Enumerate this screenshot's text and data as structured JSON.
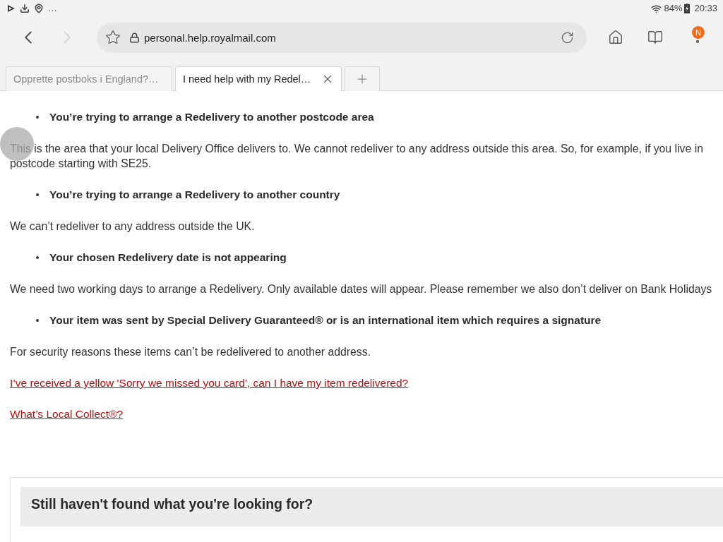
{
  "status_bar": {
    "more_notifications": "…",
    "battery": "84%",
    "time": "20:33"
  },
  "toolbar": {
    "nav": [
      {
        "kind": "back",
        "disabled": false
      },
      {
        "kind": "forward",
        "disabled": true
      }
    ],
    "url": "personal.help.royalmail.com",
    "menu_badge": "N"
  },
  "tabs": [
    {
      "title": "Opprette postboks i England?…",
      "selected": false
    },
    {
      "title": "I need help with my Redel…",
      "selected": true
    }
  ],
  "article": {
    "blocks": [
      {
        "kind": "bullet",
        "text": "You’re trying to arrange a Redelivery to another postcode area"
      },
      {
        "kind": "paragraph",
        "lines": [
          "This is the area that your local Delivery Office delivers to. We cannot redeliver to any address outside this area. So, for example, if you live in",
          "postcode starting with SE25."
        ]
      },
      {
        "kind": "bullet",
        "text": "You’re trying to arrange a Redelivery to another country"
      },
      {
        "kind": "paragraph",
        "lines": [
          "We can’t redeliver to any address outside the UK."
        ]
      },
      {
        "kind": "bullet",
        "text": "Your chosen Redelivery date is not appearing"
      },
      {
        "kind": "paragraph",
        "lines": [
          "We need two working days to arrange a Redelivery. Only available dates will appear. Please remember we also don’t deliver on Bank Holidays"
        ]
      },
      {
        "kind": "bullet",
        "text": "Your item was sent by Special Delivery Guaranteed® or is an international item which requires a signature"
      },
      {
        "kind": "paragraph",
        "lines": [
          "For security reasons these items can’t be redelivered to another address."
        ]
      },
      {
        "kind": "link",
        "text": "I’ve received a yellow 'Sorry we missed you card', can I have my item redelivered?"
      },
      {
        "kind": "link",
        "text": "What’s Local Collect®?"
      }
    ]
  },
  "help_box": {
    "heading": "Still haven't found what you're looking for?"
  }
}
